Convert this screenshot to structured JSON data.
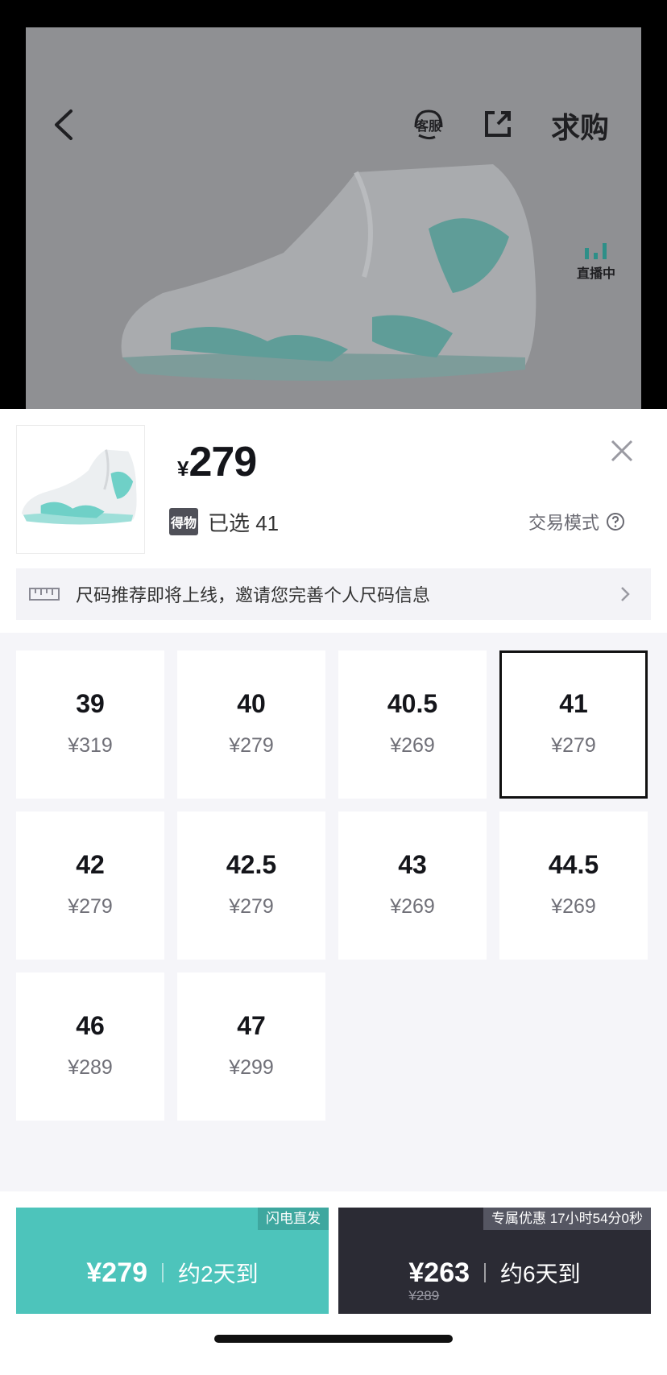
{
  "nav": {
    "service_label": "客服",
    "buy_request_label": "求购",
    "live_label": "直播中"
  },
  "product": {
    "currency": "¥",
    "price": "279",
    "selected_label": "已选",
    "selected_size": "41",
    "selected_text": "已选 41",
    "dewu_tag": "得物",
    "trade_mode_label": "交易模式"
  },
  "size_banner": {
    "text": "尺码推荐即将上线，邀请您完善个人尺码信息"
  },
  "sizes": [
    {
      "size": "39",
      "price": "¥319",
      "selected": false
    },
    {
      "size": "40",
      "price": "¥279",
      "selected": false
    },
    {
      "size": "40.5",
      "price": "¥269",
      "selected": false
    },
    {
      "size": "41",
      "price": "¥279",
      "selected": true
    },
    {
      "size": "42",
      "price": "¥279",
      "selected": false
    },
    {
      "size": "42.5",
      "price": "¥279",
      "selected": false
    },
    {
      "size": "43",
      "price": "¥269",
      "selected": false
    },
    {
      "size": "44.5",
      "price": "¥269",
      "selected": false
    },
    {
      "size": "46",
      "price": "¥289",
      "selected": false
    },
    {
      "size": "47",
      "price": "¥299",
      "selected": false
    }
  ],
  "actions": {
    "fast": {
      "tag": "闪电直发",
      "price": "¥279",
      "eta": "约2天到"
    },
    "slow": {
      "tag": "专属优惠 17小时54分0秒",
      "price": "¥263",
      "original_price": "¥289",
      "eta": "约6天到"
    }
  },
  "colors": {
    "accent_teal": "#4dc4bb",
    "dark_button": "#2b2b34",
    "selected_border": "#111111"
  }
}
